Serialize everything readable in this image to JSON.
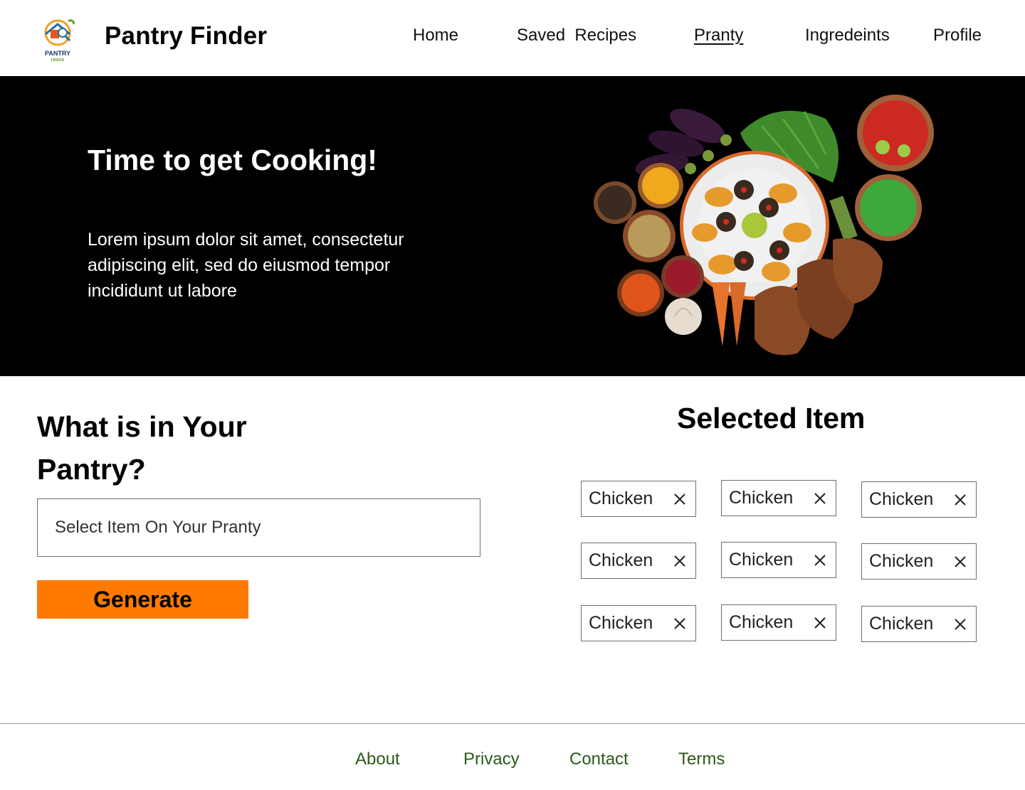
{
  "header": {
    "brand": "Pantry Finder",
    "logo_text_top": "PANTRY",
    "logo_text_bottom": "FINDER",
    "nav": [
      {
        "label": "Home",
        "active": false
      },
      {
        "label": "Saved  Recipes",
        "active": false
      },
      {
        "label": "Pranty",
        "active": true
      },
      {
        "label": "Ingredeints",
        "active": false
      },
      {
        "label": "Profile",
        "active": false
      }
    ]
  },
  "hero": {
    "title": "Time to get Cooking!",
    "text": "Lorem ipsum dolor sit amet, consectetur adipiscing elit, sed do eiusmod tempor incididunt ut labore",
    "image_icon": "food-spread-image"
  },
  "pantry": {
    "title": "What is in Your Pantry?",
    "search_placeholder": "Select Item On Your Pranty",
    "generate_label": "Generate"
  },
  "selected": {
    "title": "Selected Item",
    "items": [
      "Chicken",
      "Chicken",
      "Chicken",
      "Chicken",
      "Chicken",
      "Chicken",
      "Chicken",
      "Chicken",
      "Chicken"
    ],
    "remove_icon": "close-icon"
  },
  "footer": {
    "links": [
      "About",
      "Privacy",
      "Contact",
      "Terms"
    ]
  },
  "colors": {
    "accent": "#ff7a00",
    "hero_bg": "#000000",
    "footer_link": "#2c5a1a"
  }
}
